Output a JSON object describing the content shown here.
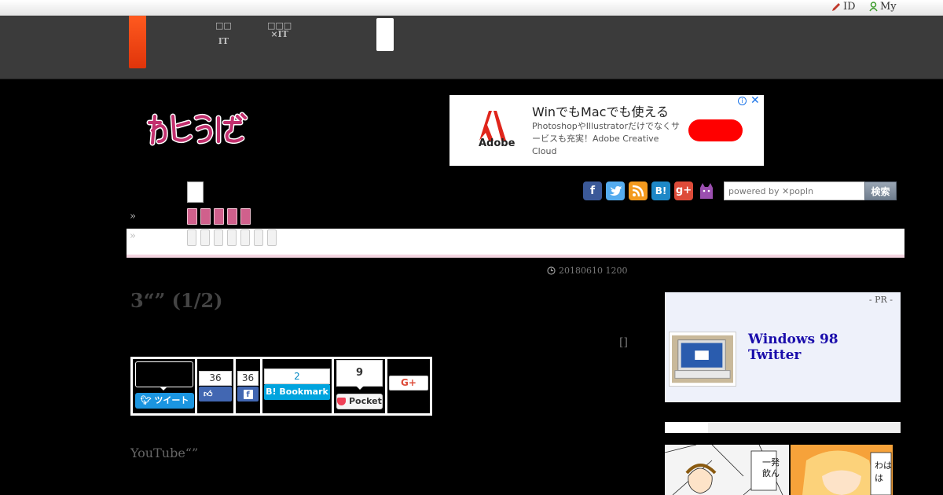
{
  "topbar": {
    "id_label": "ID",
    "my_label": "My"
  },
  "gnav": {
    "item1_line1": "□□",
    "item1_line2": "IT",
    "item2_line1": "□□□",
    "item2_line2": "×IT"
  },
  "ad": {
    "headline": "WinでもMacでも使える",
    "body": "PhotoshopやIllustratorだけでなくサービスも充実！Adobe Creative Cloud",
    "brand": "Adobe",
    "info": "i",
    "close": "✕"
  },
  "nav": {
    "raquo": "»"
  },
  "search": {
    "placeholder": "powered by ✕popIn",
    "button": "検索"
  },
  "article": {
    "date": "20180610 1200",
    "title": "3“” (1/2)",
    "byline": "[]",
    "lead": "YouTube“”"
  },
  "share": {
    "tweet_label": "ツイート",
    "like_count": "36",
    "fb_count": "36",
    "hatena_count": "2",
    "hatena_label": "B! Bookmark",
    "pocket_count": "9",
    "pocket_label": "Pocket",
    "gplus_label": "G+"
  },
  "sidebar": {
    "pr_label": "- PR -",
    "pr_title_line1": "Windows 98",
    "pr_title_line2": "Twitter"
  },
  "colors": {
    "brand_orange": "#ff4a12",
    "nav_pink": "#d0608c",
    "twitter": "#1b95e0",
    "facebook": "#3b5998",
    "hatena": "#00a4de",
    "pocket": "#ef4056"
  }
}
